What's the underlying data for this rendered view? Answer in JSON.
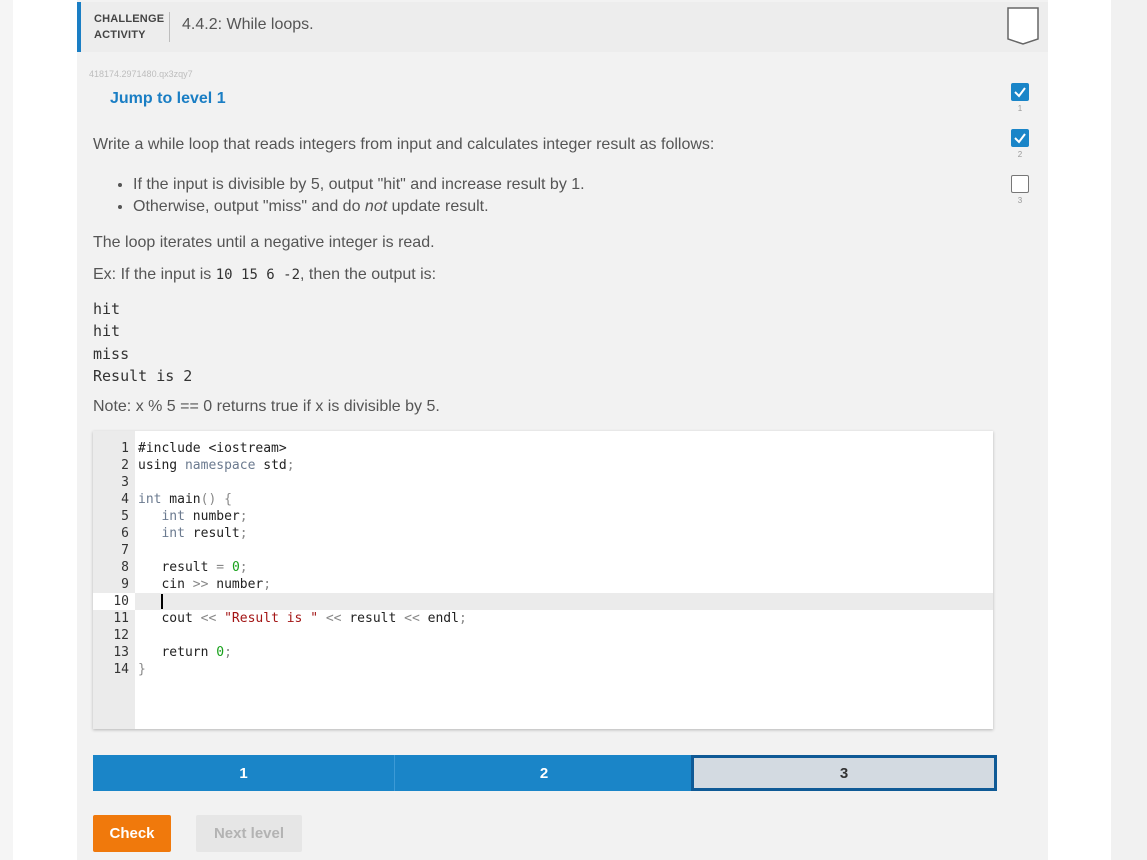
{
  "header": {
    "label_line1": "CHALLENGE",
    "label_line2": "ACTIVITY",
    "title": "4.4.2: While loops."
  },
  "activity_id": "418174.2971480.qx3zqy7",
  "jump_link": "Jump to level 1",
  "prompt": {
    "intro": "Write a while loop that reads integers from input and calculates integer result as follows:",
    "bullet1": "If the input is divisible by 5, output \"hit\" and increase result by 1.",
    "bullet2_a": "Otherwise, output \"miss\" and do ",
    "bullet2_em": "not",
    "bullet2_b": " update result.",
    "loop_note": "The loop iterates until a negative integer is read.",
    "example_a": "Ex: If the input is ",
    "example_code": "10 15 6 -2",
    "example_b": ", then the output is:",
    "output_lines": [
      "hit",
      "hit",
      "miss",
      "Result is 2"
    ],
    "note": "Note: x % 5 == 0 returns true if x is divisible by 5."
  },
  "editor": {
    "active_line": 10,
    "line_numbers": [
      "1",
      "2",
      "3",
      "4",
      "5",
      "6",
      "7",
      "8",
      "9",
      "10",
      "11",
      "12",
      "13",
      "14"
    ]
  },
  "levels": [
    {
      "label": "1",
      "state": "done"
    },
    {
      "label": "2",
      "state": "done"
    },
    {
      "label": "3",
      "state": "current"
    }
  ],
  "buttons": {
    "check": "Check",
    "next": "Next level"
  },
  "side_levels": [
    {
      "label": "1",
      "state": "done"
    },
    {
      "label": "2",
      "state": "done"
    },
    {
      "label": "3",
      "state": "todo"
    }
  ],
  "colors": {
    "accent": "#1a85c8",
    "check": "#f0790c"
  }
}
